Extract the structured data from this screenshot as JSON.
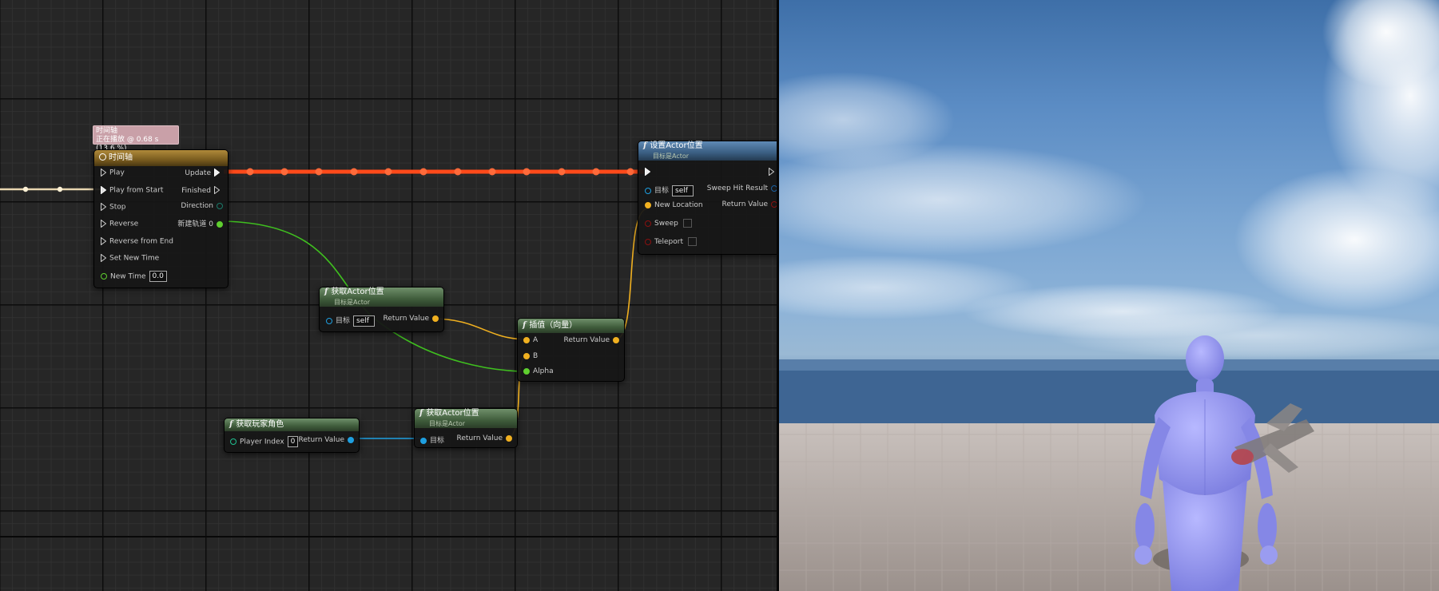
{
  "timeline_status": {
    "title": "时间轴",
    "playing": "正在播放 @ 0.68 s (13.6 %)"
  },
  "timeline_node": {
    "title": "时间轴",
    "inputs": [
      "Play",
      "Play from Start",
      "Stop",
      "Reverse",
      "Reverse from End",
      "Set New Time",
      "New Time"
    ],
    "new_time_value": "0.0",
    "outputs": [
      "Update",
      "Finished",
      "Direction",
      "新建轨道 0"
    ]
  },
  "set_actor_location": {
    "title": "设置Actor位置",
    "subtitle": "目标是Actor",
    "target_label": "目标",
    "target_value": "self",
    "new_location": "New Location",
    "sweep": "Sweep",
    "teleport": "Teleport",
    "sweep_hit_result": "Sweep Hit Result",
    "return_value": "Return Value"
  },
  "get_actor_location_1": {
    "title": "获取Actor位置",
    "subtitle": "目标是Actor",
    "target_label": "目标",
    "target_value": "self",
    "return_value": "Return Value"
  },
  "lerp_vector": {
    "title": "插值（向量）",
    "a": "A",
    "b": "B",
    "alpha": "Alpha",
    "return_value": "Return Value"
  },
  "get_player_character": {
    "title": "获取玩家角色",
    "player_index_label": "Player Index",
    "player_index_value": "0",
    "return_value": "Return Value"
  },
  "get_actor_location_2": {
    "title": "获取Actor位置",
    "subtitle": "目标是Actor",
    "target_label": "目标",
    "return_value": "Return Value"
  },
  "colors": {
    "exec_active": "#ff4a1a",
    "vector_pin": "#f0c030",
    "float_pin": "#5fcf2f",
    "object_pin": "#1e9fe0",
    "mannequin": "#8e90ee"
  }
}
